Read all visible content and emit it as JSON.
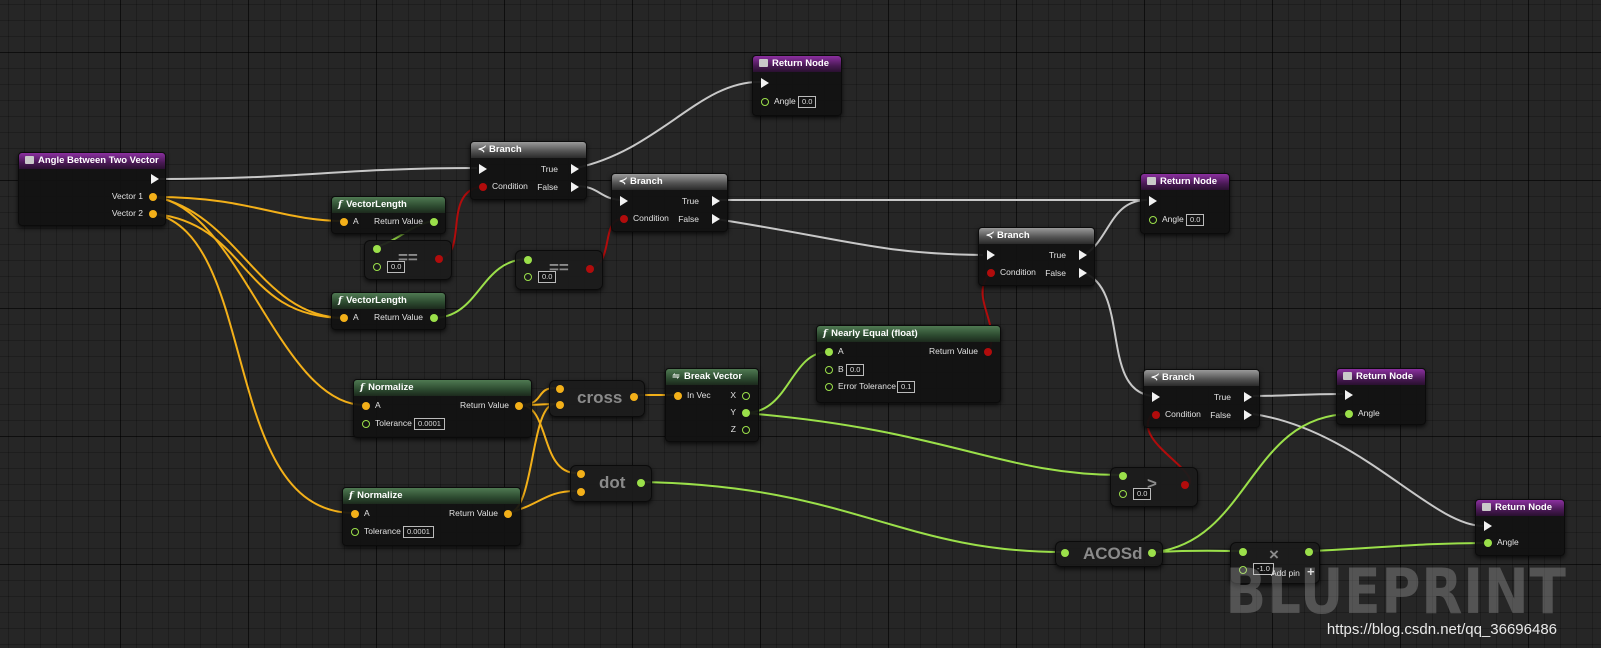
{
  "graph": {
    "entry": {
      "title": "Angle Between Two Vector",
      "vec1": "Vector 1",
      "vec2": "Vector 2"
    },
    "vlen1": {
      "title": "VectorLength",
      "a": "A",
      "ret": "Return Value"
    },
    "vlen2": {
      "title": "VectorLength",
      "a": "A",
      "ret": "Return Value"
    },
    "eq1": {
      "op": "==",
      "val": "0.0"
    },
    "eq2": {
      "op": "==",
      "val": "0.0"
    },
    "branch1": {
      "title": "Branch",
      "t": "True",
      "f": "False",
      "cond": "Condition"
    },
    "branch2": {
      "title": "Branch",
      "t": "True",
      "f": "False",
      "cond": "Condition"
    },
    "branch3": {
      "title": "Branch",
      "t": "True",
      "f": "False",
      "cond": "Condition"
    },
    "branch4": {
      "title": "Branch",
      "t": "True",
      "f": "False",
      "cond": "Condition"
    },
    "ret1": {
      "title": "Return Node",
      "pin": "Angle",
      "val": "0.0"
    },
    "ret2": {
      "title": "Return Node",
      "pin": "Angle",
      "val": "0.0"
    },
    "ret3": {
      "title": "Return Node",
      "pin": "Angle"
    },
    "ret4": {
      "title": "Return Node",
      "pin": "Angle"
    },
    "norm1": {
      "title": "Normalize",
      "a": "A",
      "ret": "Return Value",
      "tol": "Tolerance",
      "tolv": "0.0001"
    },
    "norm2": {
      "title": "Normalize",
      "a": "A",
      "ret": "Return Value",
      "tol": "Tolerance",
      "tolv": "0.0001"
    },
    "cross": {
      "title": "cross"
    },
    "dot": {
      "title": "dot"
    },
    "breakvec": {
      "title": "Break Vector",
      "invec": "In Vec",
      "x": "X",
      "y": "Y",
      "z": "Z"
    },
    "nearly": {
      "title": "Nearly Equal (float)",
      "a": "A",
      "b": "B",
      "bval": "0.0",
      "ret": "Return Value",
      "tol": "Error Tolerance",
      "tolv": "0.1"
    },
    "gt": {
      "op": ">",
      "val": "0.0"
    },
    "acos": {
      "title": "ACOSd"
    },
    "mul": {
      "op": "×",
      "val": "-1.0",
      "add": "Add pin",
      "plus": "+"
    }
  },
  "watermark": "BLUEPRINT",
  "url": "https://blog.csdn.net/qq_36696486",
  "colors": {
    "exec": "#f2f2f2",
    "vector": "#f3b019",
    "float": "#9be04a",
    "bool": "#b10c0c",
    "function_header": "#2c4a2f",
    "return_header": "#4a1a55"
  }
}
